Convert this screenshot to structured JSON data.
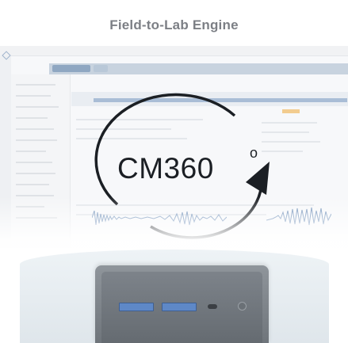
{
  "header": {
    "title": "Field-to-Lab Engine"
  },
  "logo": {
    "text": "CM360",
    "degree": "o"
  },
  "colors": {
    "title": "#7c7f85",
    "logo": "#1b1f24",
    "device": "#7d838a",
    "usb": "#5e88c7"
  }
}
